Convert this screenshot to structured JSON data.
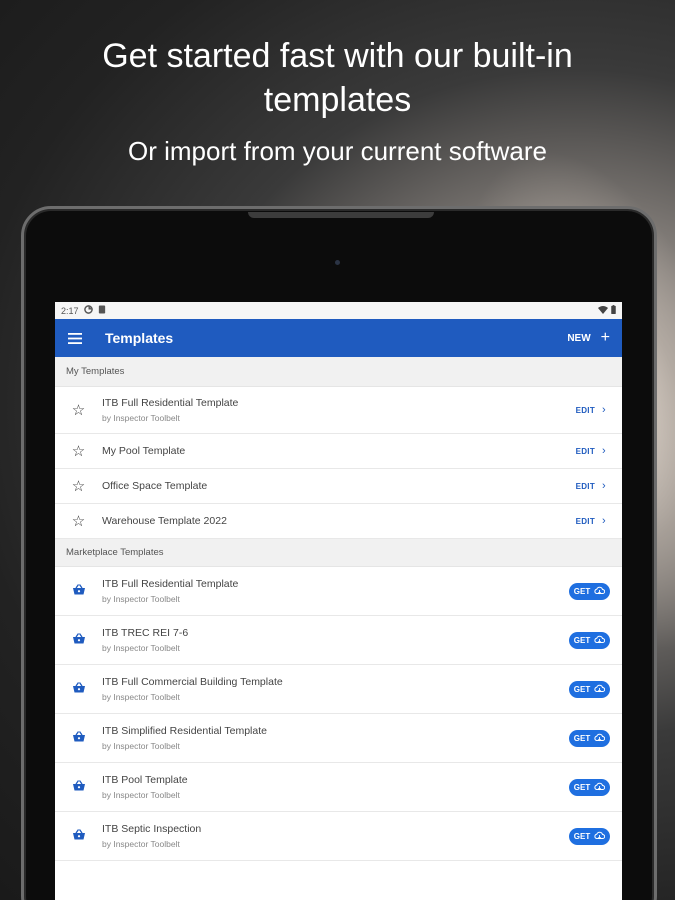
{
  "headline": {
    "line1": "Get started fast with our built-in",
    "line2": "templates",
    "subline": "Or import from your current software"
  },
  "statusbar": {
    "time": "2:17"
  },
  "appbar": {
    "title": "Templates",
    "new_label": "NEW",
    "menu_icon": "hamburger-menu-icon",
    "plus_icon": "plus-icon"
  },
  "my_templates": {
    "header": "My Templates",
    "edit_label": "EDIT",
    "items": [
      {
        "title": "ITB Full Residential Template",
        "author": "by Inspector Toolbelt"
      },
      {
        "title": "My Pool Template",
        "author": ""
      },
      {
        "title": "Office Space Template",
        "author": ""
      },
      {
        "title": "Warehouse Template 2022",
        "author": ""
      }
    ]
  },
  "marketplace": {
    "header": "Marketplace Templates",
    "get_label": "GET",
    "items": [
      {
        "title": "ITB Full Residential Template",
        "author": "by Inspector Toolbelt"
      },
      {
        "title": "ITB TREC REI 7-6",
        "author": "by Inspector Toolbelt"
      },
      {
        "title": "ITB Full Commercial Building Template",
        "author": "by Inspector Toolbelt"
      },
      {
        "title": "ITB Simplified Residential Template",
        "author": "by Inspector Toolbelt"
      },
      {
        "title": "ITB Pool Template",
        "author": "by Inspector Toolbelt"
      },
      {
        "title": "ITB Septic Inspection",
        "author": "by Inspector Toolbelt"
      }
    ]
  },
  "colors": {
    "appbar": "#1f5bbf",
    "get_button": "#1f6fe0"
  }
}
